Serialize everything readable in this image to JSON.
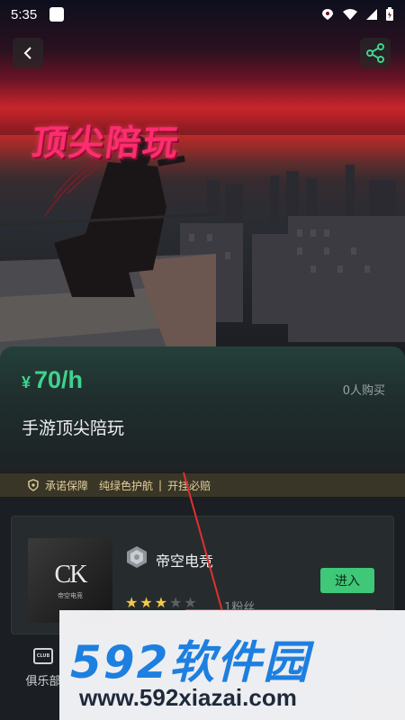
{
  "status_bar": {
    "time": "5:35"
  },
  "hero": {
    "title": "顶尖陪玩"
  },
  "product": {
    "currency": "¥",
    "price": "70/h",
    "buyers": "0人购买",
    "title": "手游顶尖陪玩"
  },
  "guarantee": {
    "items": [
      "承诺保障",
      "纯绿色护航",
      "开挂必赔"
    ],
    "color": "#e0cf9a"
  },
  "club": {
    "logo_text": "CK",
    "logo_sub": "帝空电竞",
    "name": "帝空电竞",
    "enter_label": "进入",
    "rating": 3,
    "rating_max": 5,
    "fans": "1粉丝"
  },
  "bottom_nav": {
    "club_icon": "CLUB",
    "club_label": "俱乐部"
  },
  "watermark": {
    "logo": "592软件园",
    "url": "www.592xiazai.com"
  },
  "colors": {
    "accent_green": "#3fd28e",
    "enter_button": "#3fc878",
    "hero_title": "#ff2d6f",
    "watermark_blue": "#1d7fe0"
  }
}
